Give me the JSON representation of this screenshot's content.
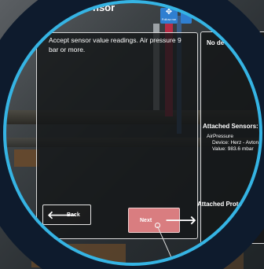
{
  "header": {
    "title": "nsor",
    "buttons": [
      {
        "icon": "move-icon",
        "label": "Follow me"
      },
      {
        "icon": "pin-icon",
        "label": ""
      }
    ]
  },
  "instruction_panel": {
    "text": "Accept sensor value readings. Air pressure 9 bar or more.",
    "back_label": "Back",
    "next_label": "Next"
  },
  "info_panel": {
    "no_data_label": "No de",
    "attached_sensors_heading": "Attached Sensors:",
    "sensor_name": "AirPressure",
    "device_line": "Device: Herz - Avton",
    "value_line": "Value:  983.6 mbar",
    "attached_protocols_heading": "Attached Protocols"
  },
  "colors": {
    "frame": "#35b4e4",
    "next_button": "#d97d80",
    "header_button": "#2f7fd1"
  }
}
